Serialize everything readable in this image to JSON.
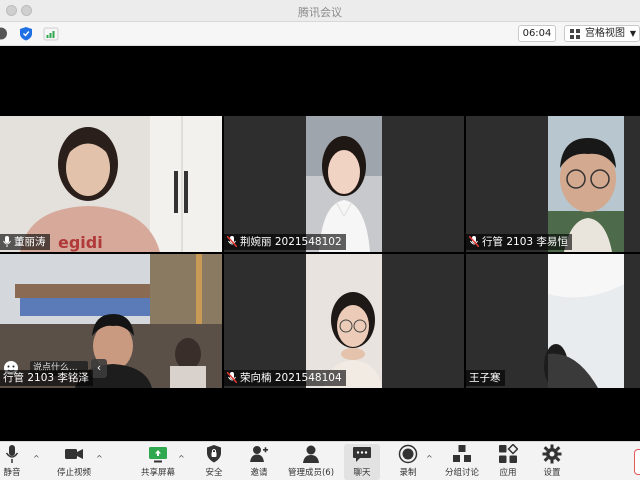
{
  "window": {
    "title": "腾讯会议"
  },
  "topbar": {
    "timer": "06:04",
    "view_label": "宫格视图"
  },
  "participants": [
    {
      "name": "董丽涛"
    },
    {
      "name": "荆婉丽 2021548102"
    },
    {
      "name": "行管 2103 李易恒"
    },
    {
      "name": "行管 2103 李铭泽"
    },
    {
      "name": "荣向楠 2021548104"
    },
    {
      "name": "王子寒"
    }
  ],
  "overlay": {
    "say_placeholder": "说点什么..."
  },
  "toolbar": {
    "mute": "静音",
    "stop_video": "停止视频",
    "share_screen": "共享屏幕",
    "security": "安全",
    "invite": "邀请",
    "manage_members": "管理成员(6)",
    "chat": "聊天",
    "record": "录制",
    "breakout": "分组讨论",
    "apps": "应用",
    "settings": "设置"
  },
  "colors": {
    "accent_green": "#2fa84f",
    "shield_blue": "#1f6fe5",
    "chrome_bg": "#f3f3f3"
  }
}
